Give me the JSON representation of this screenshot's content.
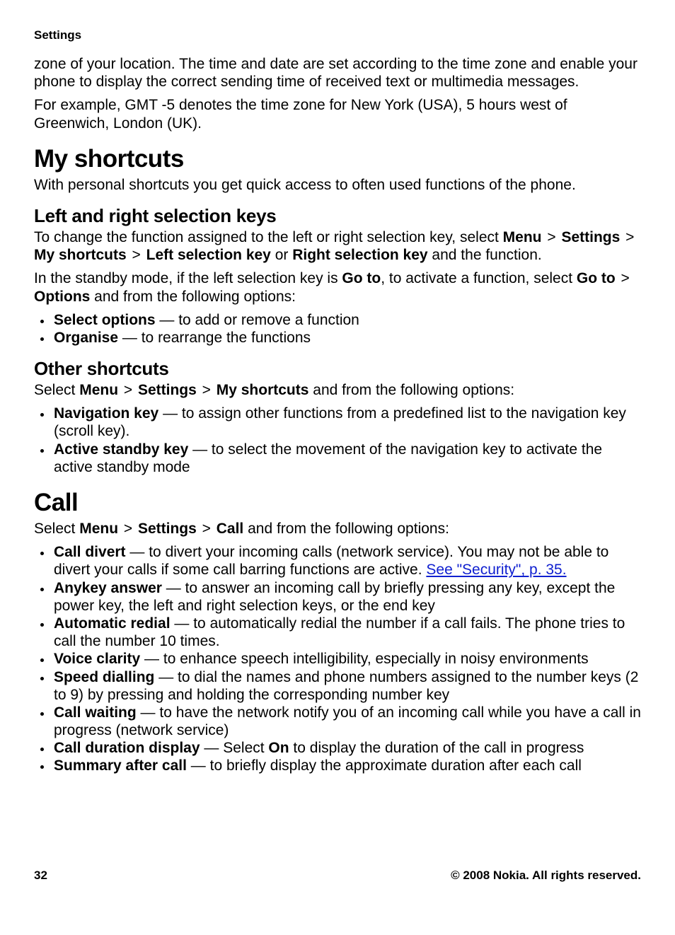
{
  "header": "Settings",
  "intro_p1": "zone of your location. The time and date are set according to the time zone and enable your phone to display the correct sending time of received text or multimedia messages.",
  "intro_p2": "For example, GMT -5 denotes the time zone for New York (USA), 5 hours west of Greenwich, London (UK).",
  "shortcuts": {
    "heading": "My shortcuts",
    "lead": "With personal shortcuts you get quick access to often used functions of the phone.",
    "lrkeys": {
      "heading": "Left and right selection keys",
      "p1_pre": "To change the function assigned to the left or right selection key, select ",
      "menu": "Menu",
      "gt": " > ",
      "settings": "Settings",
      "my_shortcuts": "My shortcuts",
      "left_sel": "Left selection key",
      "or": " or ",
      "right_sel": "Right selection key",
      "p1_post": " and the function.",
      "p2_pre": "In the standby mode, if the left selection key is ",
      "goto1": "Go to",
      "p2_mid": ", to activate a function, select ",
      "goto2": "Go to",
      "options": "Options",
      "p2_post": " and from the following options:",
      "items": [
        {
          "label": "Select options",
          "desc": " — to add or remove a function"
        },
        {
          "label": "Organise",
          "desc": " — to rearrange the functions"
        }
      ]
    },
    "other": {
      "heading": "Other shortcuts",
      "p_pre": "Select ",
      "menu": "Menu",
      "gt": " > ",
      "settings": "Settings",
      "my_shortcuts": "My shortcuts",
      "p_post": " and from the following options:",
      "items": [
        {
          "label": "Navigation key",
          "desc": " — to assign other functions from a predefined list to the navigation key (scroll key)."
        },
        {
          "label": "Active standby key",
          "desc": " — to select the movement of the navigation key to activate the active standby mode"
        }
      ]
    }
  },
  "call": {
    "heading": "Call",
    "p_pre": "Select ",
    "menu": "Menu",
    "gt": " > ",
    "settings": "Settings",
    "call": "Call",
    "p_post": " and from the following options:",
    "items": [
      {
        "label": "Call divert",
        "desc_pre": " — to divert your incoming calls (network service). You may not be able to divert your calls if some call barring functions are active. ",
        "link": "See \"Security\", p. 35."
      },
      {
        "label": "Anykey answer",
        "desc": " — to answer an incoming call by briefly pressing any key, except the power key, the left and right selection keys, or the end key"
      },
      {
        "label": "Automatic redial",
        "desc": " — to automatically redial the number if a call fails. The phone tries to call the number 10 times."
      },
      {
        "label": "Voice clarity",
        "desc": " — to enhance speech intelligibility, especially in noisy environments"
      },
      {
        "label": "Speed dialling",
        "desc": " — to dial the names and phone numbers assigned to the number keys (2 to 9) by pressing and holding the corresponding number key"
      },
      {
        "label": "Call waiting",
        "desc": " — to have the network notify you of an incoming call while you have a call in progress (network service)"
      },
      {
        "label": "Call duration display",
        "desc_pre": " — Select ",
        "on": "On",
        "desc_post": " to display the duration of the call in progress"
      },
      {
        "label": "Summary after call",
        "desc": " — to briefly display the approximate duration after each call"
      }
    ]
  },
  "footer": {
    "page": "32",
    "copyright": "© 2008 Nokia. All rights reserved."
  }
}
